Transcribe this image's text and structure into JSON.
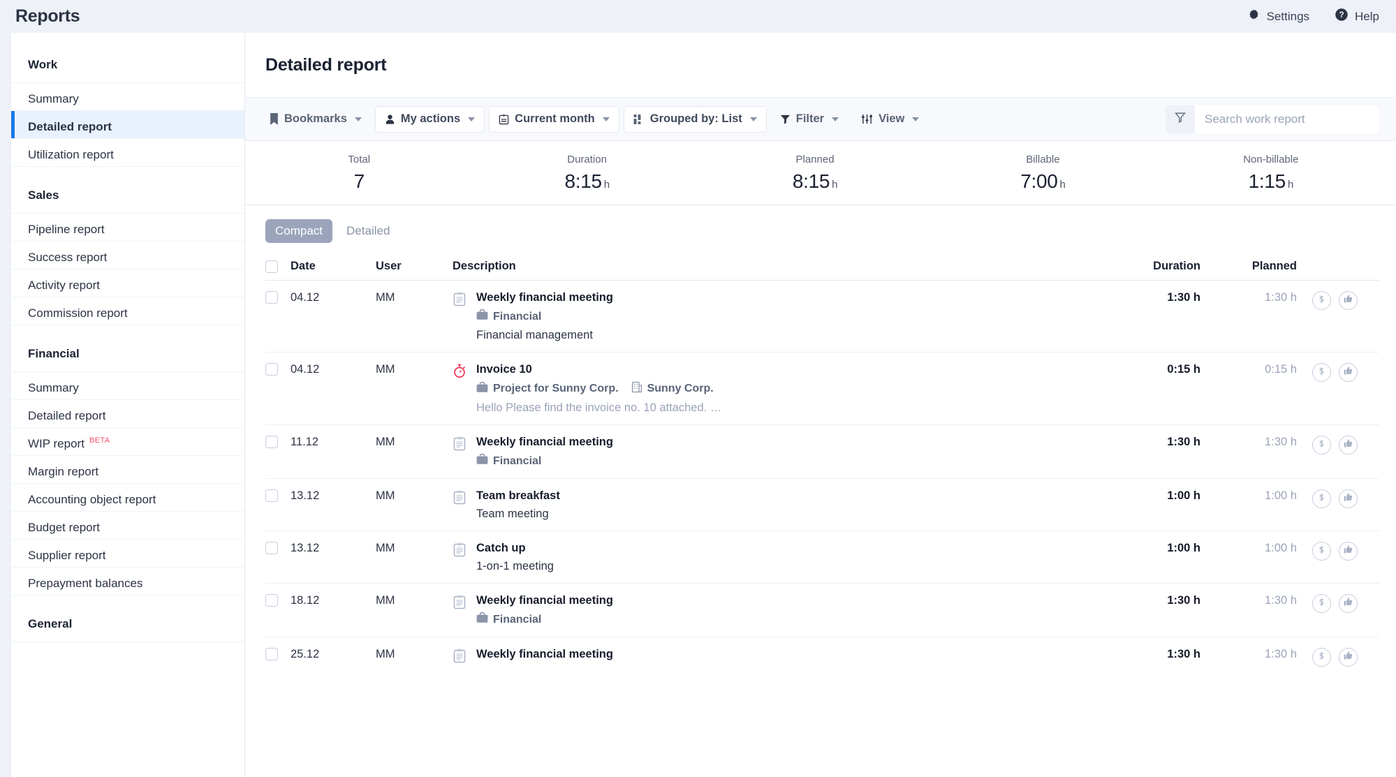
{
  "app": {
    "title": "Reports",
    "settings_label": "Settings",
    "help_label": "Help"
  },
  "sidebar": {
    "groups": [
      {
        "title": "Work",
        "items": [
          {
            "label": "Summary",
            "active": false
          },
          {
            "label": "Detailed report",
            "active": true
          },
          {
            "label": "Utilization report",
            "active": false
          }
        ]
      },
      {
        "title": "Sales",
        "items": [
          {
            "label": "Pipeline report",
            "active": false
          },
          {
            "label": "Success report",
            "active": false
          },
          {
            "label": "Activity report",
            "active": false
          },
          {
            "label": "Commission report",
            "active": false
          }
        ]
      },
      {
        "title": "Financial",
        "items": [
          {
            "label": "Summary",
            "active": false
          },
          {
            "label": "Detailed report",
            "active": false
          },
          {
            "label": "WIP report",
            "badge": "BETA",
            "active": false
          },
          {
            "label": "Margin report",
            "active": false
          },
          {
            "label": "Accounting object report",
            "active": false
          },
          {
            "label": "Budget report",
            "active": false
          },
          {
            "label": "Supplier report",
            "active": false
          },
          {
            "label": "Prepayment balances",
            "active": false
          }
        ]
      },
      {
        "title": "General",
        "items": []
      }
    ]
  },
  "main": {
    "page_title": "Detailed report"
  },
  "toolbar": {
    "bookmarks": "Bookmarks",
    "my_actions": "My actions",
    "current_month": "Current month",
    "grouped_by": "Grouped by: List",
    "filter": "Filter",
    "view": "View",
    "search_placeholder": "Search work report",
    "search_value": ""
  },
  "stats": [
    {
      "label": "Total",
      "value": "7",
      "unit": ""
    },
    {
      "label": "Duration",
      "value": "8:15",
      "unit": "h"
    },
    {
      "label": "Planned",
      "value": "8:15",
      "unit": "h"
    },
    {
      "label": "Billable",
      "value": "7:00",
      "unit": "h"
    },
    {
      "label": "Non-billable",
      "value": "1:15",
      "unit": "h"
    }
  ],
  "tabs": [
    {
      "label": "Compact",
      "active": true
    },
    {
      "label": "Detailed",
      "active": false
    }
  ],
  "table": {
    "columns": {
      "date": "Date",
      "user": "User",
      "description": "Description",
      "duration": "Duration",
      "planned": "Planned"
    },
    "rows": [
      {
        "date": "04.12",
        "user": "MM",
        "icon": "clipboard-icon",
        "title": "Weekly financial meeting",
        "project": "Financial",
        "customer": "",
        "sub": "Financial management",
        "sub_muted": "",
        "duration": "1:30 h",
        "planned": "1:30 h"
      },
      {
        "date": "04.12",
        "user": "MM",
        "icon": "stopwatch-icon",
        "title": "Invoice 10",
        "project": "Project for Sunny Corp.",
        "customer": "Sunny Corp.",
        "sub": "",
        "sub_muted": "Hello   Please find the invoice no. 10 attached.  …",
        "duration": "0:15 h",
        "planned": "0:15 h"
      },
      {
        "date": "11.12",
        "user": "MM",
        "icon": "clipboard-icon",
        "title": "Weekly financial meeting",
        "project": "Financial",
        "customer": "",
        "sub": "",
        "sub_muted": "",
        "duration": "1:30 h",
        "planned": "1:30 h"
      },
      {
        "date": "13.12",
        "user": "MM",
        "icon": "clipboard-icon",
        "title": "Team breakfast",
        "project": "",
        "customer": "",
        "sub": "Team meeting",
        "sub_muted": "",
        "duration": "1:00 h",
        "planned": "1:00 h"
      },
      {
        "date": "13.12",
        "user": "MM",
        "icon": "clipboard-icon",
        "title": "Catch up",
        "project": "",
        "customer": "",
        "sub": "1-on-1 meeting",
        "sub_muted": "",
        "duration": "1:00 h",
        "planned": "1:00 h"
      },
      {
        "date": "18.12",
        "user": "MM",
        "icon": "clipboard-icon",
        "title": "Weekly financial meeting",
        "project": "Financial",
        "customer": "",
        "sub": "",
        "sub_muted": "",
        "duration": "1:30 h",
        "planned": "1:30 h"
      },
      {
        "date": "25.12",
        "user": "MM",
        "icon": "clipboard-icon",
        "title": "Weekly financial meeting",
        "project": "",
        "customer": "",
        "sub": "",
        "sub_muted": "",
        "duration": "1:30 h",
        "planned": "1:30 h"
      }
    ]
  },
  "colors": {
    "accent_blue": "#1a7ae8",
    "page_bg": "#eef1f8",
    "active_nav_bg": "#e9f1fc",
    "beta_red": "#f0506e",
    "tab_active_bg": "#9ba4bb",
    "muted_text": "#9aa3b8"
  }
}
